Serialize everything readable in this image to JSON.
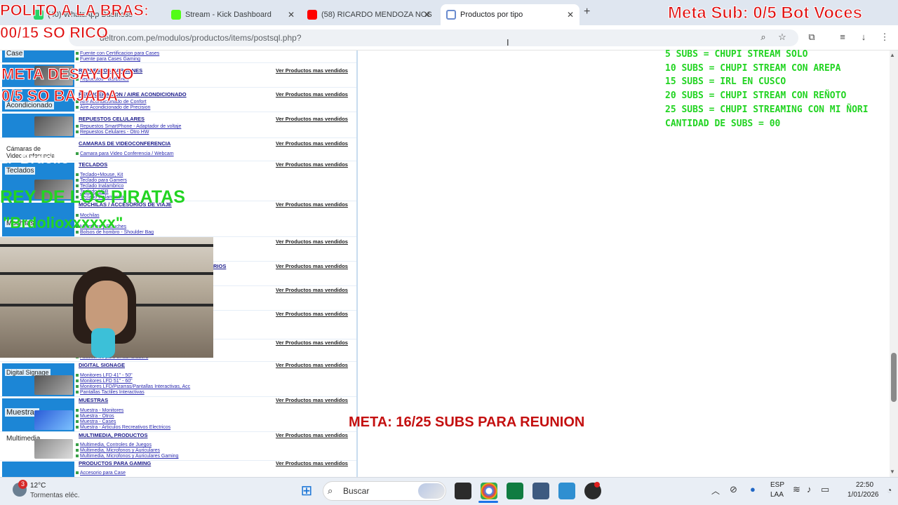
{
  "browser": {
    "tabs": [
      {
        "title": "(40) WhatsApp Business"
      },
      {
        "title": "Stream - Kick Dashboard"
      },
      {
        "title": "(58) RICARDO MENDOZA NOS"
      },
      {
        "title": "Productos por tipo"
      }
    ],
    "url": "deltron.com.pe/modulos/productos/items/postsql.php?"
  },
  "page": {
    "view_link": "Ver Productos mas vendidos",
    "rows": [
      {
        "thumb": "Case",
        "category": "",
        "subs": [
          "Fuente con Certificacion para Cases",
          "Fuente para Cases Gaming"
        ]
      },
      {
        "thumb": "",
        "category": "REPUESTOS BARBONES",
        "subs": [
          "Repuestos - Barbones"
        ]
      },
      {
        "thumb": "Acondicionado",
        "category": "REFRIGERACION / AIRE ACONDICIONADO",
        "subs": [
          "Aire Acondicionado de Confort",
          "Aire Acondicionado de Precision"
        ]
      },
      {
        "thumb": "",
        "category": "REPUESTOS CELULARES",
        "subs": [
          "Repuestos SmartPhone - Adaptador de voltaje",
          "Repuestos Celulares - Otro HW"
        ]
      },
      {
        "thumb": "Cámaras de Videoconferencia",
        "category": "CAMARAS DE VIDEOCONFERENCIA",
        "subs": [
          "Camara para Video Conferencia / Webcam"
        ]
      },
      {
        "thumb": "Teclados",
        "category": "TECLADOS",
        "subs": [
          "Teclado+Mouse, Kit",
          "Teclado para Gamers",
          "Teclado Inalambrico",
          "Teclado USB",
          "Teclado Inalambrico"
        ]
      },
      {
        "thumb": "Mochilas",
        "category": "MOCHILAS / ACCESORIOS DE VIAJE",
        "subs": [
          "Mochilas",
          "Maletines y Estuches",
          "Bolsos de hombro - Shoulder Bag"
        ]
      },
      {
        "thumb": "",
        "category": "",
        "subs": []
      },
      {
        "thumb": "",
        "category": "RIOS",
        "subs": []
      },
      {
        "thumb": "",
        "category": "",
        "subs": []
      },
      {
        "thumb": "",
        "category": "",
        "subs": []
      },
      {
        "thumb": "",
        "category": "",
        "subs": [
          "Accesorios para Ensambladora"
        ]
      },
      {
        "thumb": "Digital Signage",
        "category": "DIGITAL SIGNAGE",
        "subs": [
          "Monitores LFD 41\" - 50\"",
          "Monitores LFD 51\" - 60\"",
          "Monitores LFD/Pizarras/Pantallas Interactivas, Acc",
          "Pantallas Tactiles Interactivas"
        ]
      },
      {
        "thumb": "Muestras",
        "category": "MUESTRAS",
        "subs": [
          "Muestra - Monitores",
          "Muestra - Otros",
          "Muestra - Cases",
          "Muestra - Articulos Recreativos Electricos"
        ]
      },
      {
        "thumb": "Multimedia",
        "category": "MULTIMEDIA, PRODUCTOS",
        "subs": [
          "Multimedia, Controles de Juegos",
          "Multimedia, Microfonos y Auriculares",
          "Multimedia, Microfonos y Auriculares Gaming"
        ]
      },
      {
        "thumb": "",
        "category": "PRODUCTOS PARA GAMING",
        "subs": [
          "Accesorio para Case"
        ]
      }
    ]
  },
  "overlays": {
    "polito": "POLITO A LA BRAS:",
    "polito_count": "00/15 SO RICO",
    "meta_sub": "Meta Sub: 0/5 Bot Voces",
    "meta_desayuno": "META DESAYUNO",
    "desayuno_count": "0/5 SO BAJADA",
    "ranking_line": "1.- Brdolio",
    "rey_title": "REY DE LOS PIRATAS",
    "rey_name": "\"Brdolioxxxxxx\"",
    "goals": [
      "5 SUBS = CHUPI STREAM SOLO",
      "10 SUBS = CHUPI STREAM CON AREPA",
      "15 SUBS = IRL EN CUSCO",
      "20 SUBS = CHUPI STREAM CON REÑOTO",
      "25 SUBS = CHUPI STREAMING CON MI ÑORI",
      "CANTIDAD DE SUBS = 00"
    ],
    "meta_reunion": "META: 16/25 SUBS PARA REUNION"
  },
  "taskbar": {
    "weather_temp": "12°C",
    "weather_desc": "Tormentas eléc.",
    "weather_badge": "3",
    "search": "Buscar",
    "lang1": "ESP",
    "lang2": "LAA",
    "time": "22:50",
    "date": "1/01/2026"
  },
  "colors": {
    "accent": "#1c86d6",
    "overlay_red": "#e01010",
    "overlay_green": "#22d422"
  }
}
